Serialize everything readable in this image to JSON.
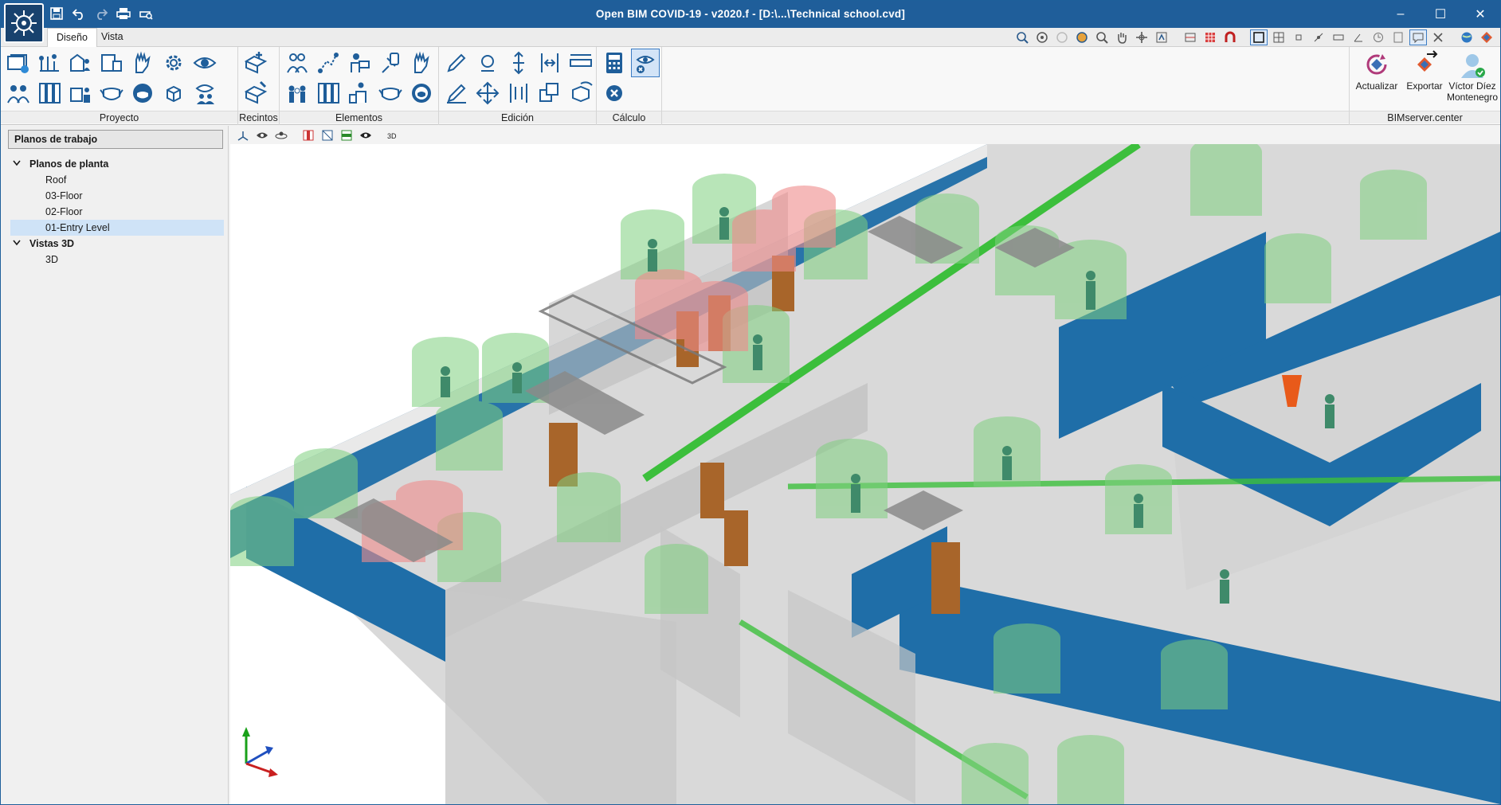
{
  "window": {
    "title": "Open BIM COVID-19 - v2020.f - [D:\\...\\Technical school.cvd]",
    "controls": {
      "minimize": "–",
      "maximize": "☐",
      "close": "✕"
    }
  },
  "tabs": [
    {
      "label": "Diseño",
      "active": true
    },
    {
      "label": "Vista",
      "active": false
    }
  ],
  "ribbon": {
    "groups": {
      "proyecto": "Proyecto",
      "recintos": "Recintos",
      "elementos": "Elementos",
      "edicion": "Edición",
      "calculo": "Cálculo",
      "bimserver": "BIMserver.center"
    },
    "bimserver": {
      "update_label": "Actualizar",
      "export_label": "Exportar",
      "user_name": "Víctor Díez Montenegro"
    }
  },
  "panel": {
    "header": "Planos de trabajo",
    "tree": {
      "floor_plans": {
        "label": "Planos de planta",
        "items": [
          "Roof",
          "03-Floor",
          "02-Floor",
          "01-Entry Level"
        ],
        "selected": "01-Entry Level"
      },
      "views_3d": {
        "label": "Vistas 3D",
        "items": [
          "3D"
        ]
      }
    }
  },
  "colors": {
    "titlebar": "#1f5e9a",
    "accent": "#3b7cc4",
    "glass_blue": "#1f6ea8",
    "route_green": "#3cbf3c",
    "safe_zone_green": "#7fd07f",
    "risk_zone_red": "#f08c8c",
    "door_brown": "#a8652a"
  }
}
